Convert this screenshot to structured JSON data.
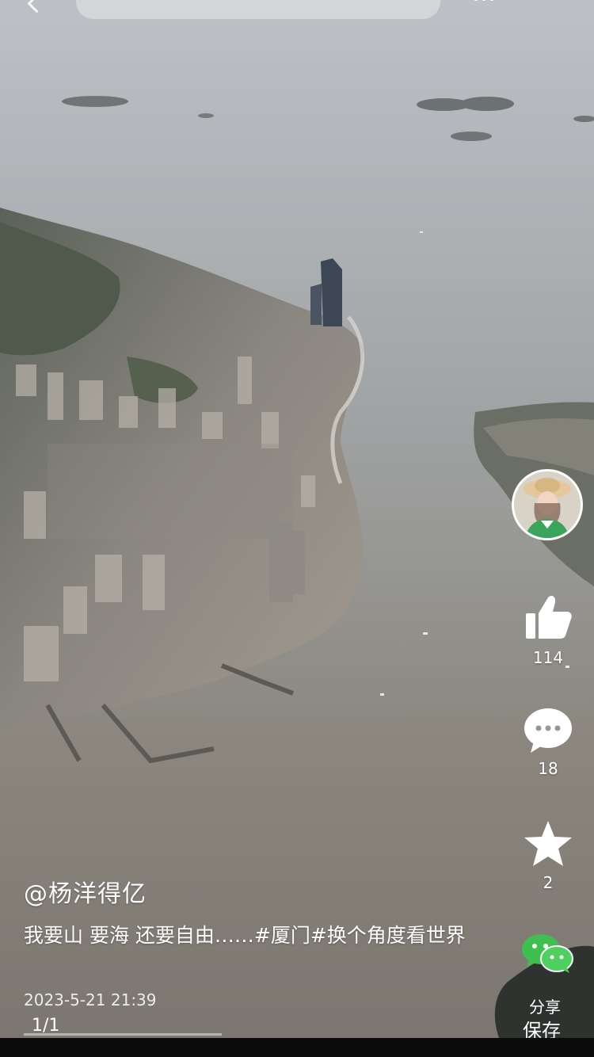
{
  "search": {
    "placeholder": ""
  },
  "author": {
    "handle": "@杨洋得亿"
  },
  "post": {
    "caption": "我要山 要海 还要自由……#厦门#换个角度看世界",
    "timestamp": "2023-5-21 21:39",
    "page_indicator": "1/1"
  },
  "actions": {
    "likes": "114",
    "comments": "18",
    "favorites": "2",
    "share_label": "分享",
    "save_label": "保存"
  },
  "colors": {
    "icon": "#ffffff",
    "wechat_green": "#3fbf4f"
  }
}
